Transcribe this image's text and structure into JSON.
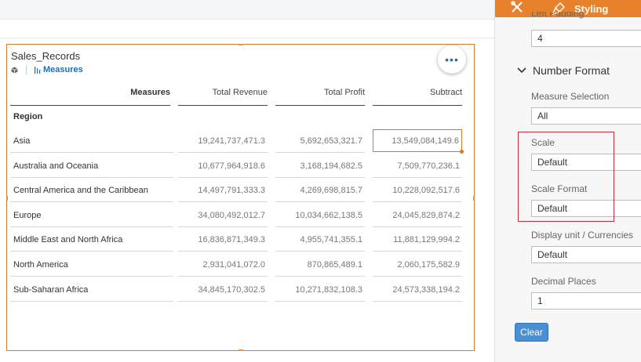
{
  "widget": {
    "title": "Sales_Records",
    "measures_link": "Measures",
    "more_glyph": "•••"
  },
  "table": {
    "headers": [
      "Measures",
      "Total Revenue",
      "Total Profit",
      "Subtract"
    ],
    "region_label": "Region",
    "rows": [
      {
        "label": "Asia",
        "values": [
          "19,241,737,471.3",
          "5,692,653,321.7",
          "13,549,084,149.6"
        ]
      },
      {
        "label": "Australia and Oceania",
        "values": [
          "10,677,964,918.6",
          "3,168,194,682.5",
          "7,509,770,236.1"
        ]
      },
      {
        "label": "Central America and the Caribbean",
        "values": [
          "14,497,791,333.3",
          "4,269,698,815.7",
          "10,228,092,517.6"
        ]
      },
      {
        "label": "Europe",
        "values": [
          "34,080,492,012.7",
          "10,034,662,138.5",
          "24,045,829,874.2"
        ]
      },
      {
        "label": "Middle East and North Africa",
        "values": [
          "16,836,871,349.3",
          "4,955,741,355.1",
          "11,881,129,994.2"
        ]
      },
      {
        "label": "North America",
        "values": [
          "2,931,041,072.0",
          "870,865,489.1",
          "2,060,175,582.9"
        ]
      },
      {
        "label": "Sub-Saharan Africa",
        "values": [
          "34,845,170,302.5",
          "10,271,832,108.3",
          "24,573,338,194.2"
        ]
      }
    ]
  },
  "panel": {
    "tab_styling": "Styling",
    "left_padding_label": "Left Padding",
    "left_padding_value": "4",
    "section_title": "Number Format",
    "measure_selection_label": "Measure Selection",
    "measure_selection_value": "All",
    "scale_label": "Scale",
    "scale_value": "Default",
    "scale_format_label": "Scale Format",
    "scale_format_value": "Default",
    "display_unit_label": "Display unit / Currencies",
    "display_unit_value": "Default",
    "decimal_places_label": "Decimal Places",
    "decimal_places_value": "1",
    "clear_label": "Clear"
  },
  "colors": {
    "accent_orange": "#e8812b",
    "link_blue": "#1a6fb5",
    "highlight_red": "#cc2b3a",
    "button_blue": "#4a8fd1"
  }
}
